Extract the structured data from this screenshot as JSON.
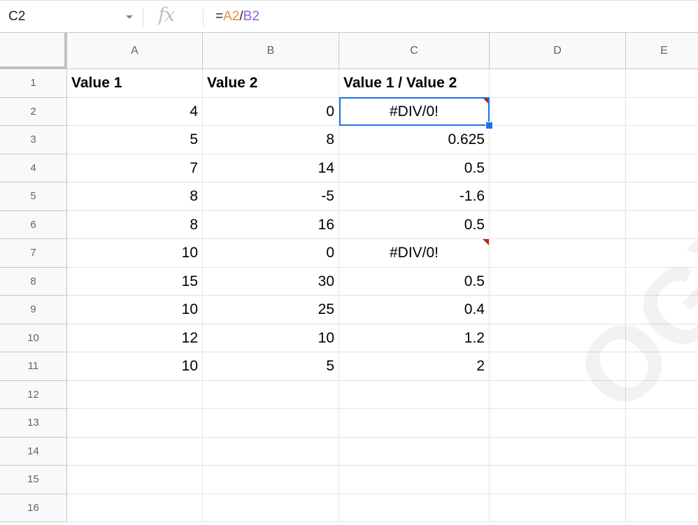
{
  "formula_bar": {
    "name_box": "C2",
    "fx_label": "fx",
    "formula_prefix": "=",
    "formula_ref1": "A2",
    "formula_op": "/",
    "formula_ref2": "B2"
  },
  "columns": [
    "A",
    "B",
    "C",
    "D",
    "E"
  ],
  "rows": [
    {
      "n": "1",
      "a": "Value 1",
      "b": "Value 2",
      "c": "Value 1 / Value 2",
      "header": true
    },
    {
      "n": "2",
      "a": "4",
      "b": "0",
      "c": "#DIV/0!",
      "error": true
    },
    {
      "n": "3",
      "a": "5",
      "b": "8",
      "c": "0.625"
    },
    {
      "n": "4",
      "a": "7",
      "b": "14",
      "c": "0.5"
    },
    {
      "n": "5",
      "a": "8",
      "b": "-5",
      "c": "-1.6"
    },
    {
      "n": "6",
      "a": "8",
      "b": "16",
      "c": "0.5"
    },
    {
      "n": "7",
      "a": "10",
      "b": "0",
      "c": "#DIV/0!",
      "error": true
    },
    {
      "n": "8",
      "a": "15",
      "b": "30",
      "c": "0.5"
    },
    {
      "n": "9",
      "a": "10",
      "b": "25",
      "c": "0.4"
    },
    {
      "n": "10",
      "a": "12",
      "b": "10",
      "c": "1.2"
    },
    {
      "n": "11",
      "a": "10",
      "b": "5",
      "c": "2"
    },
    {
      "n": "12",
      "a": "",
      "b": "",
      "c": ""
    },
    {
      "n": "13",
      "a": "",
      "b": "",
      "c": ""
    },
    {
      "n": "14",
      "a": "",
      "b": "",
      "c": ""
    },
    {
      "n": "15",
      "a": "",
      "b": "",
      "c": ""
    },
    {
      "n": "16",
      "a": "",
      "b": "",
      "c": ""
    }
  ],
  "selected_cell": "C2",
  "colors": {
    "selection": "#1a73e8",
    "comment_marker": "#c5221f",
    "ref1": "#e69138",
    "ref2": "#8e63ce"
  }
}
